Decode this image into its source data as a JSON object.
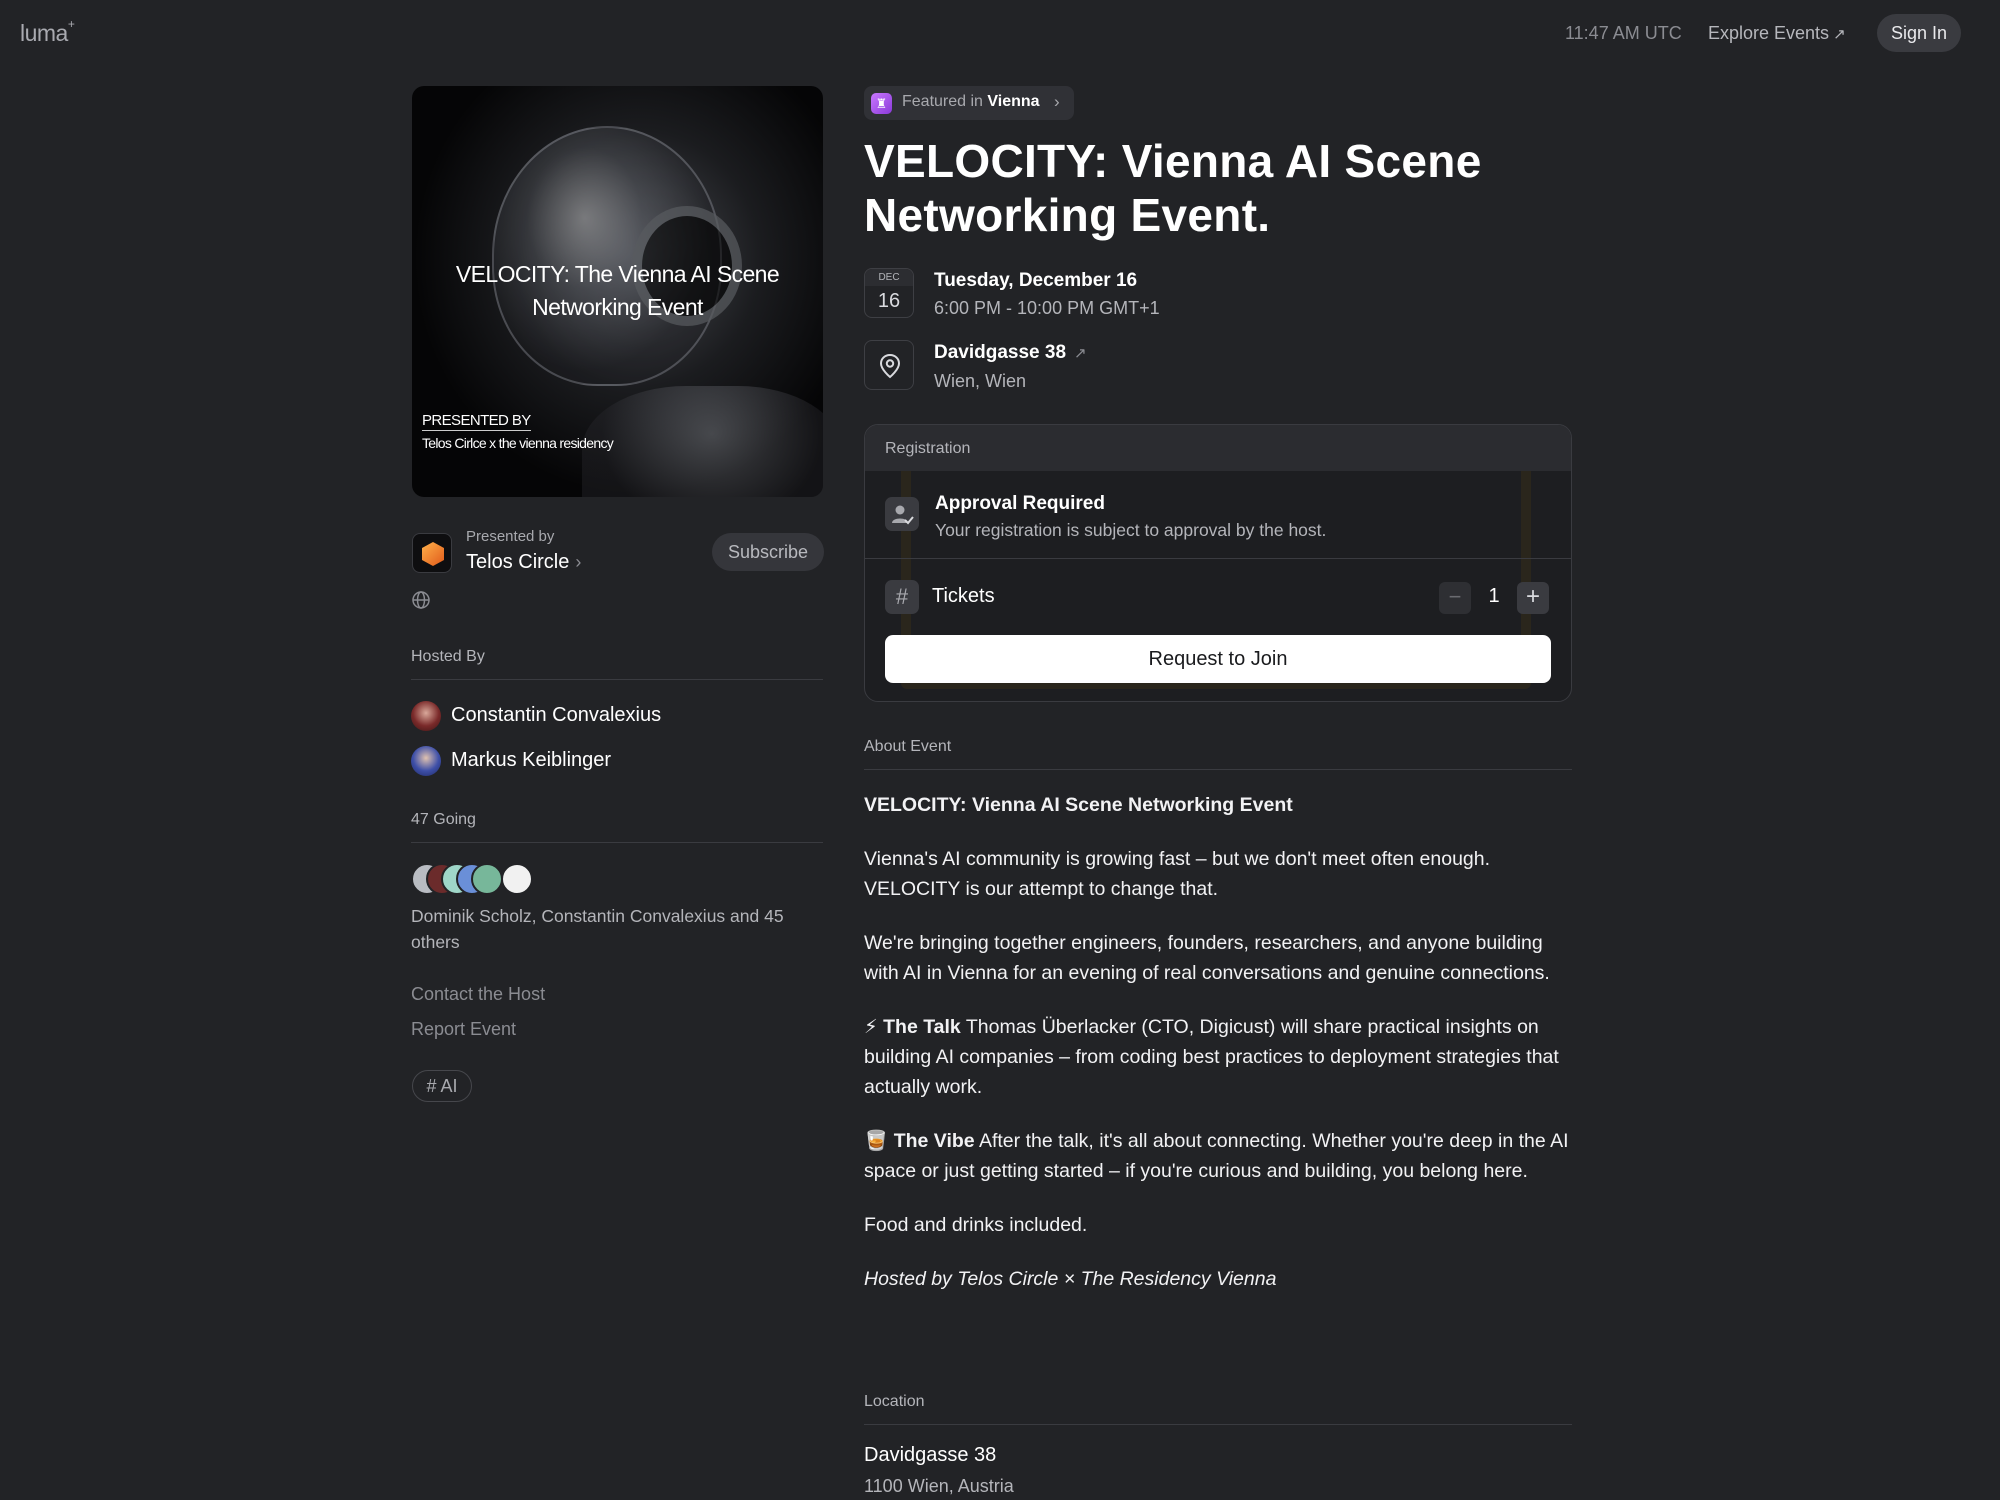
{
  "nav": {
    "logo": "luma",
    "logo_mark": "+",
    "time": "11:47 AM UTC",
    "explore_label": "Explore Events",
    "explore_arrow": "↗",
    "signin_label": "Sign In"
  },
  "cover": {
    "title_line1": "VELOCITY: The Vienna AI Scene",
    "title_line2": "Networking Event",
    "presented_line": "PRESENTED BY",
    "presenters_line": "Telos Cirlce x the vienna residency"
  },
  "presenter": {
    "label": "Presented by",
    "name": "Telos Circle",
    "chevron": "›",
    "subscribe_label": "Subscribe"
  },
  "hosts": {
    "label": "Hosted By",
    "items": [
      {
        "name": "Constantin Convalexius",
        "color": "#7a2a2a"
      },
      {
        "name": "Markus Keiblinger",
        "color": "#3d4fa8"
      }
    ]
  },
  "going": {
    "label": "47 Going",
    "names": "Dominik Scholz, Constantin Convalexius and 45 others",
    "avatar_colors": [
      "#b9bcc2",
      "#6b2b2b",
      "#9fd6c8",
      "#6a8fd8",
      "#77b79a",
      "#f1f1f1"
    ]
  },
  "side_links": {
    "contact": "Contact the Host",
    "report": "Report Event"
  },
  "tag": "# AI",
  "featured": {
    "icon": "♜",
    "prefix": "Featured in",
    "city": "Vienna",
    "chevron": "›"
  },
  "event": {
    "title_line1": "VELOCITY: Vienna AI Scene",
    "title_line2": "Networking Event."
  },
  "date": {
    "month": "DEC",
    "day": "16",
    "main": "Tuesday, December 16",
    "time": "6:00 PM - 10:00 PM GMT+1"
  },
  "location": {
    "name": "Davidgasse 38",
    "arrow": "↗",
    "city": "Wien, Wien"
  },
  "registration": {
    "header": "Registration",
    "approval_title": "Approval Required",
    "approval_sub": "Your registration is subject to approval by the host.",
    "tickets_icon": "#",
    "tickets_label": "Tickets",
    "minus": "−",
    "quantity": "1",
    "plus": "+",
    "join_label": "Request to Join"
  },
  "about": {
    "label": "About Event",
    "heading": "VELOCITY: Vienna AI Scene Networking Event",
    "p1": "Vienna's AI community is growing fast – but we don't meet often enough. VELOCITY is our attempt to change that.",
    "p2": "We're bringing together engineers, founders, researchers, and anyone building with AI in Vienna for an evening of real conversations and genuine connections.",
    "talk_emoji": "⚡",
    "talk_title": "The Talk",
    "talk_text": " Thomas Überlacker (CTO, Digicust) will share practical insights on building AI companies – from coding best practices to deployment strategies that actually work.",
    "vibe_emoji": "🥃",
    "vibe_title": "The Vibe",
    "vibe_text": " After the talk, it's all about connecting. Whether you're deep in the AI space or just getting started – if you're curious and building, you belong here.",
    "food": "Food and drinks included.",
    "hosted": "Hosted by Telos Circle × The Residency Vienna"
  },
  "location_section": {
    "label": "Location",
    "name": "Davidgasse 38",
    "address": "1100 Wien, Austria"
  }
}
